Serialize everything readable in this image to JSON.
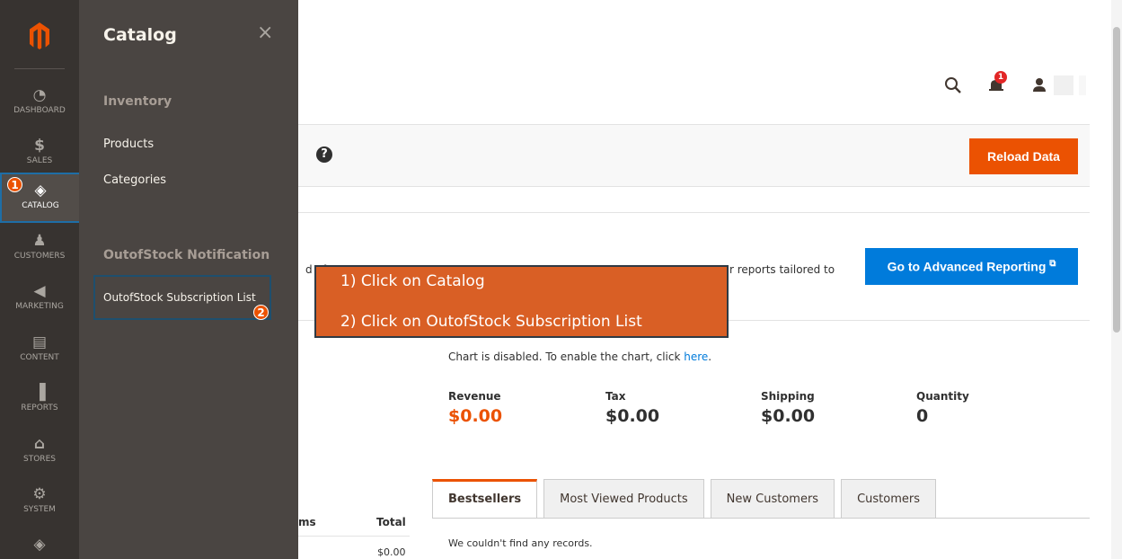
{
  "nav": {
    "items": [
      {
        "label": "DASHBOARD",
        "icon": "dashboard-icon",
        "glyph": "◔"
      },
      {
        "label": "SALES",
        "icon": "dollar-icon",
        "glyph": "$"
      },
      {
        "label": "CATALOG",
        "icon": "box-icon",
        "glyph": "◈"
      },
      {
        "label": "CUSTOMERS",
        "icon": "person-icon",
        "glyph": "♟"
      },
      {
        "label": "MARKETING",
        "icon": "megaphone-icon",
        "glyph": "◀"
      },
      {
        "label": "CONTENT",
        "icon": "layout-icon",
        "glyph": "▤"
      },
      {
        "label": "REPORTS",
        "icon": "bar-chart-icon",
        "glyph": "▐"
      },
      {
        "label": "STORES",
        "icon": "store-icon",
        "glyph": "⌂"
      },
      {
        "label": "SYSTEM",
        "icon": "gear-icon",
        "glyph": "⚙"
      },
      {
        "label": "",
        "icon": "extension-icon",
        "glyph": "◈"
      }
    ],
    "step1": "1"
  },
  "flyout": {
    "title": "Catalog",
    "close": "×",
    "group1": "Inventory",
    "link_products": "Products",
    "link_categories": "Categories",
    "group2": "OutofStock Notification",
    "link_subscription": "OutofStock Subscription List",
    "step2": "2"
  },
  "header": {
    "notification_count": "1"
  },
  "page_actions": {
    "help": "?",
    "reload_label": "Reload Data"
  },
  "reporting": {
    "desc_left": "d of",
    "desc_right": "r reports tailored to",
    "button_label": "Go to Advanced Reporting"
  },
  "callout": {
    "line1": "1) Click on Catalog",
    "line2": "2) Click on OutofStock Subscription List"
  },
  "chart_note": {
    "text": "Chart is disabled. To enable the chart, click ",
    "link": "here",
    "after": "."
  },
  "stats": [
    {
      "label": "Revenue",
      "value": "$0.00"
    },
    {
      "label": "Tax",
      "value": "$0.00"
    },
    {
      "label": "Shipping",
      "value": "$0.00"
    },
    {
      "label": "Quantity",
      "value": "0"
    }
  ],
  "tabs": [
    "Bestsellers",
    "Most Viewed Products",
    "New Customers",
    "Customers"
  ],
  "tab_content": "We couldn't find any records.",
  "left_table": {
    "col_items": "ms",
    "col_total": "Total",
    "value": "$0.00"
  },
  "colors": {
    "accent": "#eb5202",
    "link": "#007bdb",
    "nav_bg": "#373330"
  }
}
